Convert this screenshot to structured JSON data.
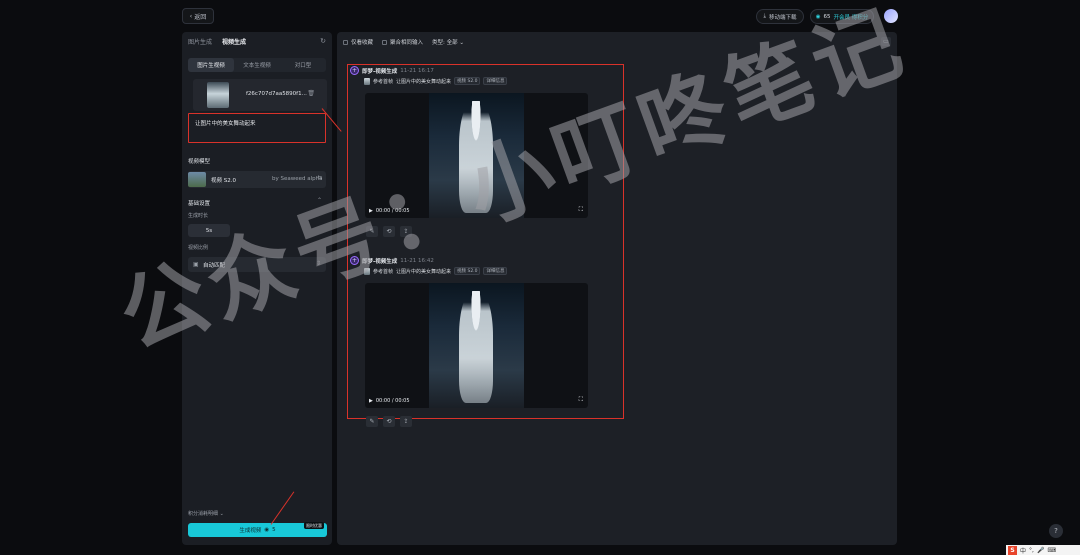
{
  "topbar": {
    "back_label": "返回",
    "download_label": "移动端下载",
    "points_value": "65",
    "vip_label": "开会员 得积分",
    "colors": {
      "accent": "#18c8d8"
    }
  },
  "left_panel": {
    "tabs": [
      {
        "label": "图片生成",
        "active": false
      },
      {
        "label": "视频生成",
        "active": true
      }
    ],
    "subtabs": [
      {
        "label": "图片生视频",
        "active": true
      },
      {
        "label": "文本生视频",
        "active": false
      },
      {
        "label": "对口型",
        "active": false
      }
    ],
    "upload_filename": "f26c707d7aa5890f1...",
    "prompt_text": "让图片中的美女舞动起来",
    "model_section_label": "视频模型",
    "model_name": "视频 S2.0",
    "model_by": "by Seaweed alpha",
    "basic_settings_label": "基础设置",
    "duration_label": "生成时长",
    "duration_value": "5s",
    "ratio_label": "视频比例",
    "ratio_value": "自动匹配",
    "points_detail_label": "积分消耗明细",
    "generate_label": "生成视频",
    "generate_cost": "5",
    "limited_tag": "限时优惠"
  },
  "main": {
    "filters": [
      {
        "label": "仅看收藏",
        "type": "checkbox"
      },
      {
        "label": "聚合相同输入",
        "type": "checkbox"
      },
      {
        "label": "类型: 全部",
        "type": "dropdown"
      }
    ],
    "cards": [
      {
        "title": "即梦-视频生成",
        "time": "11-21  16:17",
        "ref_label": "参考首帧",
        "prompt": "让图片中的美女舞动起来",
        "model_badge": "视频 S2.0",
        "detail_badge": "详细信息",
        "time_display": "00:00  /  00:05"
      },
      {
        "title": "即梦-视频生成",
        "time": "11-21  16:42",
        "ref_label": "参考首帧",
        "prompt": "让图片中的美女舞动起来",
        "model_badge": "视频 S2.0",
        "detail_badge": "详细信息",
        "time_display": "00:00  /  00:05"
      }
    ]
  },
  "watermark": "公众号：小叮咚笔记",
  "help_label": "?",
  "ime_label": "中"
}
